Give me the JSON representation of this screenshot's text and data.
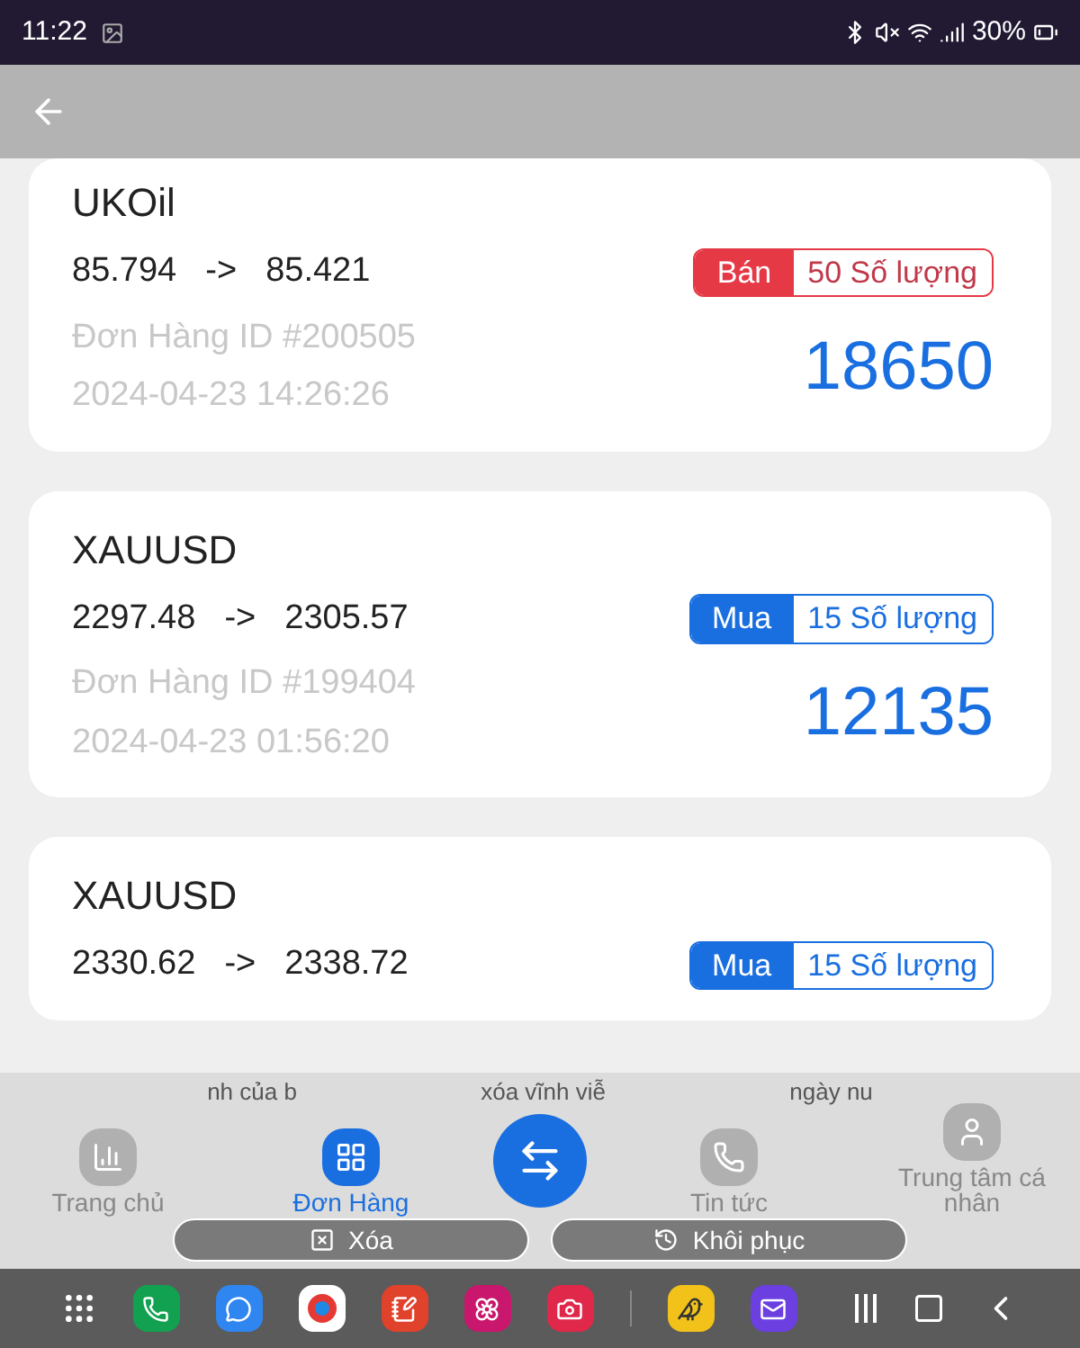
{
  "status_bar": {
    "time": "11:22",
    "battery": "30%"
  },
  "orders": [
    {
      "symbol": "UKOil",
      "open": "85.794",
      "arrow": "->",
      "close": "85.421",
      "side": "Bán",
      "kind": "sell",
      "quantity": "50 Số lượng",
      "order_id": "Đơn Hàng ID #200505",
      "time": "2024-04-23 14:26:26",
      "amount": "18650"
    },
    {
      "symbol": "XAUUSD",
      "open": "2297.48",
      "arrow": "->",
      "close": "2305.57",
      "side": "Mua",
      "kind": "buy",
      "quantity": "15 Số lượng",
      "order_id": "Đơn Hàng ID #199404",
      "time": "2024-04-23 01:56:20",
      "amount": "12135"
    },
    {
      "symbol": "XAUUSD",
      "open": "2330.62",
      "arrow": "->",
      "close": "2338.72",
      "side": "Mua",
      "kind": "buy",
      "quantity": "15 Số lượng"
    }
  ],
  "dialog_fragments": [
    "nh của b",
    "xóa vĩnh viễ",
    "ngày nu"
  ],
  "nav": [
    {
      "label": "Trang chủ",
      "kind": "home",
      "selected": false
    },
    {
      "label": "Đơn Hàng",
      "kind": "orders",
      "selected": true
    },
    {
      "label": "Tin tức",
      "kind": "news",
      "selected": false
    },
    {
      "label": "Trung tâm cá nhân",
      "kind": "profile",
      "selected": false
    }
  ],
  "buttons": [
    {
      "label": "Xóa",
      "kind": "delete"
    },
    {
      "label": "Khôi phục",
      "kind": "restore"
    }
  ]
}
